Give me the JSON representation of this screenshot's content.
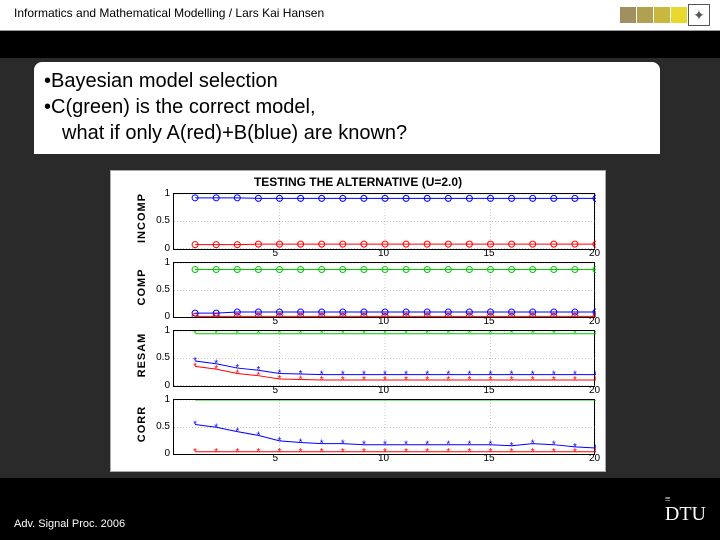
{
  "header": {
    "text": "Informatics and Mathematical Modelling / Lars Kai Hansen"
  },
  "content": {
    "bullet1": "•Bayesian model selection",
    "bullet2": "•C(green) is the correct model,",
    "bullet3": "what if only A(red)+B(blue) are known?"
  },
  "footer": {
    "text": "Adv. Signal Proc. 2006"
  },
  "logo": {
    "text": "DTU"
  },
  "chart_data": [
    {
      "type": "line",
      "title": "TESTING THE ALTERNATIVE (U=2.0)",
      "ylabel": "INCOMP",
      "ylim": [
        0,
        1
      ],
      "xlim": [
        0,
        20
      ],
      "yticks": [
        0,
        0.5,
        1
      ],
      "xticks": [
        5,
        10,
        15,
        20
      ],
      "x": [
        1,
        2,
        3,
        4,
        5,
        6,
        7,
        8,
        9,
        10,
        11,
        12,
        13,
        14,
        15,
        16,
        17,
        18,
        19,
        20
      ],
      "series": [
        {
          "name": "B",
          "color": "#0000ff",
          "marker": "o",
          "values": [
            0.93,
            0.93,
            0.93,
            0.92,
            0.92,
            0.92,
            0.92,
            0.92,
            0.92,
            0.92,
            0.92,
            0.92,
            0.92,
            0.92,
            0.92,
            0.92,
            0.92,
            0.92,
            0.92,
            0.92
          ]
        },
        {
          "name": "A",
          "color": "#ff0000",
          "marker": "o",
          "values": [
            0.07,
            0.07,
            0.07,
            0.08,
            0.08,
            0.08,
            0.08,
            0.08,
            0.08,
            0.08,
            0.08,
            0.08,
            0.08,
            0.08,
            0.08,
            0.08,
            0.08,
            0.08,
            0.08,
            0.08
          ]
        }
      ]
    },
    {
      "type": "line",
      "ylabel": "COMP",
      "ylim": [
        0,
        1
      ],
      "xlim": [
        0,
        20
      ],
      "yticks": [
        0,
        0.5,
        1
      ],
      "xticks": [
        5,
        10,
        15,
        20
      ],
      "x": [
        1,
        2,
        3,
        4,
        5,
        6,
        7,
        8,
        9,
        10,
        11,
        12,
        13,
        14,
        15,
        16,
        17,
        18,
        19,
        20
      ],
      "series": [
        {
          "name": "C",
          "color": "#00cc00",
          "marker": "o",
          "values": [
            0.88,
            0.88,
            0.88,
            0.88,
            0.88,
            0.88,
            0.88,
            0.88,
            0.88,
            0.88,
            0.88,
            0.88,
            0.88,
            0.88,
            0.88,
            0.88,
            0.88,
            0.88,
            0.88,
            0.88
          ]
        },
        {
          "name": "B",
          "color": "#0000ff",
          "marker": "o",
          "values": [
            0.08,
            0.08,
            0.1,
            0.1,
            0.1,
            0.1,
            0.1,
            0.1,
            0.1,
            0.1,
            0.1,
            0.1,
            0.1,
            0.1,
            0.1,
            0.1,
            0.1,
            0.1,
            0.1,
            0.1
          ]
        },
        {
          "name": "A",
          "color": "#ff0000",
          "marker": "o",
          "values": [
            0.02,
            0.02,
            0.02,
            0.02,
            0.02,
            0.02,
            0.02,
            0.02,
            0.02,
            0.02,
            0.02,
            0.02,
            0.02,
            0.02,
            0.02,
            0.02,
            0.02,
            0.02,
            0.02,
            0.02
          ]
        }
      ]
    },
    {
      "type": "line",
      "ylabel": "RESAM",
      "ylim": [
        0,
        1
      ],
      "xlim": [
        0,
        20
      ],
      "yticks": [
        0,
        0.5,
        1
      ],
      "xticks": [
        5,
        10,
        15,
        20
      ],
      "x": [
        1,
        2,
        3,
        4,
        5,
        6,
        7,
        8,
        9,
        10,
        11,
        12,
        13,
        14,
        15,
        16,
        17,
        18,
        19,
        20
      ],
      "series": [
        {
          "name": "C",
          "color": "#00cc00",
          "marker": "*",
          "values": [
            0.95,
            0.95,
            0.95,
            0.95,
            0.95,
            0.95,
            0.95,
            0.95,
            0.95,
            0.95,
            0.95,
            0.95,
            0.95,
            0.95,
            0.95,
            0.95,
            0.95,
            0.95,
            0.95,
            0.95
          ]
        },
        {
          "name": "B",
          "color": "#0000ff",
          "marker": "*",
          "values": [
            0.45,
            0.4,
            0.32,
            0.28,
            0.22,
            0.21,
            0.2,
            0.2,
            0.2,
            0.2,
            0.2,
            0.2,
            0.2,
            0.2,
            0.2,
            0.2,
            0.2,
            0.2,
            0.2,
            0.2
          ]
        },
        {
          "name": "A",
          "color": "#ff0000",
          "marker": "*",
          "values": [
            0.35,
            0.3,
            0.22,
            0.18,
            0.12,
            0.11,
            0.1,
            0.1,
            0.1,
            0.1,
            0.1,
            0.1,
            0.1,
            0.1,
            0.1,
            0.1,
            0.1,
            0.1,
            0.1,
            0.1
          ]
        }
      ]
    },
    {
      "type": "line",
      "ylabel": "CORR",
      "ylim": [
        0,
        1
      ],
      "xlim": [
        0,
        20
      ],
      "yticks": [
        0,
        0.5,
        1
      ],
      "xticks": [
        5,
        10,
        15,
        20
      ],
      "x": [
        1,
        2,
        3,
        4,
        5,
        6,
        7,
        8,
        9,
        10,
        11,
        12,
        13,
        14,
        15,
        16,
        17,
        18,
        19,
        20
      ],
      "series": [
        {
          "name": "C",
          "color": "#00cc00",
          "marker": "*",
          "values": [
            1.0,
            1.0,
            1.0,
            1.0,
            1.0,
            1.0,
            1.0,
            1.0,
            1.0,
            1.0,
            1.0,
            1.0,
            1.0,
            1.0,
            1.0,
            1.0,
            1.0,
            1.0,
            1.0,
            1.0
          ]
        },
        {
          "name": "B",
          "color": "#0000ff",
          "marker": "*",
          "values": [
            0.55,
            0.5,
            0.42,
            0.35,
            0.25,
            0.22,
            0.2,
            0.2,
            0.18,
            0.18,
            0.18,
            0.18,
            0.18,
            0.18,
            0.18,
            0.16,
            0.2,
            0.18,
            0.14,
            0.12
          ]
        },
        {
          "name": "A",
          "color": "#ff0000",
          "marker": "*",
          "values": [
            0.05,
            0.05,
            0.05,
            0.05,
            0.05,
            0.05,
            0.05,
            0.05,
            0.05,
            0.05,
            0.05,
            0.05,
            0.05,
            0.05,
            0.05,
            0.05,
            0.05,
            0.05,
            0.05,
            0.05
          ]
        }
      ]
    }
  ]
}
